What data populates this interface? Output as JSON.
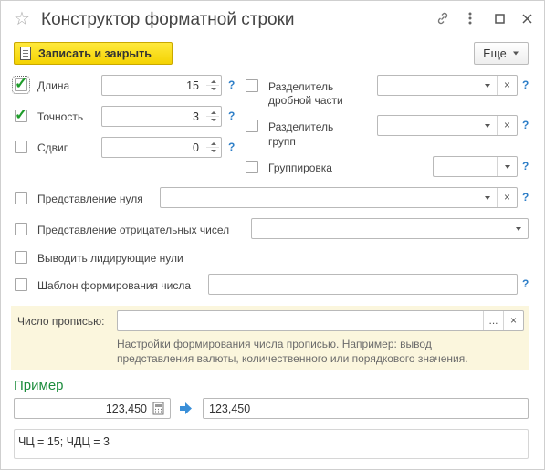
{
  "window": {
    "title": "Конструктор форматной строки",
    "star_icon": "star-icon",
    "controls": [
      "link-icon",
      "more-vert-icon",
      "maximize-icon",
      "close-icon"
    ]
  },
  "toolbar": {
    "save_label": "Записать и закрыть",
    "more_label": "Еще"
  },
  "left": {
    "length": {
      "label": "Длина",
      "checked": true,
      "value": "15"
    },
    "precision": {
      "label": "Точность",
      "checked": true,
      "value": "3"
    },
    "shift": {
      "label": "Сдвиг",
      "checked": false,
      "value": "0"
    }
  },
  "right": {
    "decimal_sep": {
      "label_line1": "Разделитель",
      "label_line2": "дробной части",
      "value": ""
    },
    "group_sep": {
      "label_line1": "Разделитель",
      "label_line2": "групп",
      "value": ""
    },
    "grouping": {
      "label": "Группировка",
      "value": ""
    }
  },
  "zero_repr": {
    "label": "Представление нуля",
    "value": ""
  },
  "neg_repr": {
    "label": "Представление отрицательных чисел",
    "value": ""
  },
  "leading_zeros": {
    "label": "Выводить лидирующие нули"
  },
  "template": {
    "label": "Шаблон формирования числа",
    "value": ""
  },
  "in_words": {
    "label": "Число прописью:",
    "value": "",
    "select_label": "...",
    "clear_label": "×",
    "hint_line1": "Настройки формирования числа прописью. Например: вывод",
    "hint_line2": "представления валюты, количественного или порядкового значения."
  },
  "help_mark": "?",
  "example": {
    "title": "Пример",
    "input_value": "123,450",
    "output_value": "123,450",
    "result": "ЧЦ = 15; ЧДЦ = 3"
  },
  "colors": {
    "accent_yellow": "#f4d302",
    "green": "#1c8c3d",
    "help_blue": "#2f7fc8",
    "hint_bg": "#fbf6dd"
  }
}
